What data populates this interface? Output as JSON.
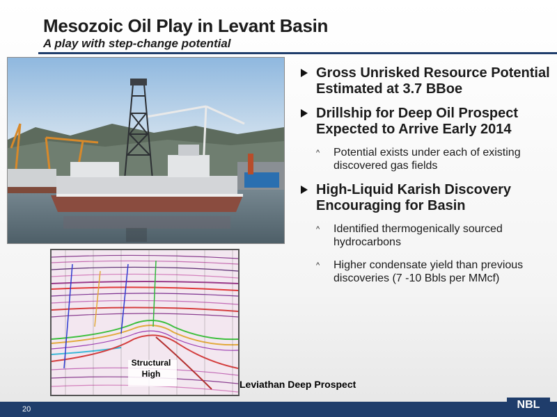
{
  "slide": {
    "title": "Mesozoic Oil Play in Levant Basin",
    "subtitle": "A play with step-change potential",
    "page_number": "20",
    "logo_text": "NBL"
  },
  "bullets": [
    {
      "level": 1,
      "text": "Gross Unrisked Resource Potential Estimated at 3.7 BBoe"
    },
    {
      "level": 1,
      "text": "Drillship for Deep Oil Prospect Expected to Arrive Early 2014"
    },
    {
      "level": 2,
      "text": "Potential exists under each of existing discovered gas fields"
    },
    {
      "level": 1,
      "text": "High-Liquid Karish Discovery Encouraging for Basin"
    },
    {
      "level": 2,
      "text": "Identified thermogenically sourced hydrocarbons"
    },
    {
      "level": 2,
      "text": "Higher condensate yield than previous discoveries (7 -10 Bbls per MMcf)"
    }
  ],
  "seismic": {
    "label": "Structural High",
    "caption": "Leviathan Deep Prospect"
  },
  "colors": {
    "accent": "#1f3d6b",
    "bullet_arrow": "#111111"
  }
}
